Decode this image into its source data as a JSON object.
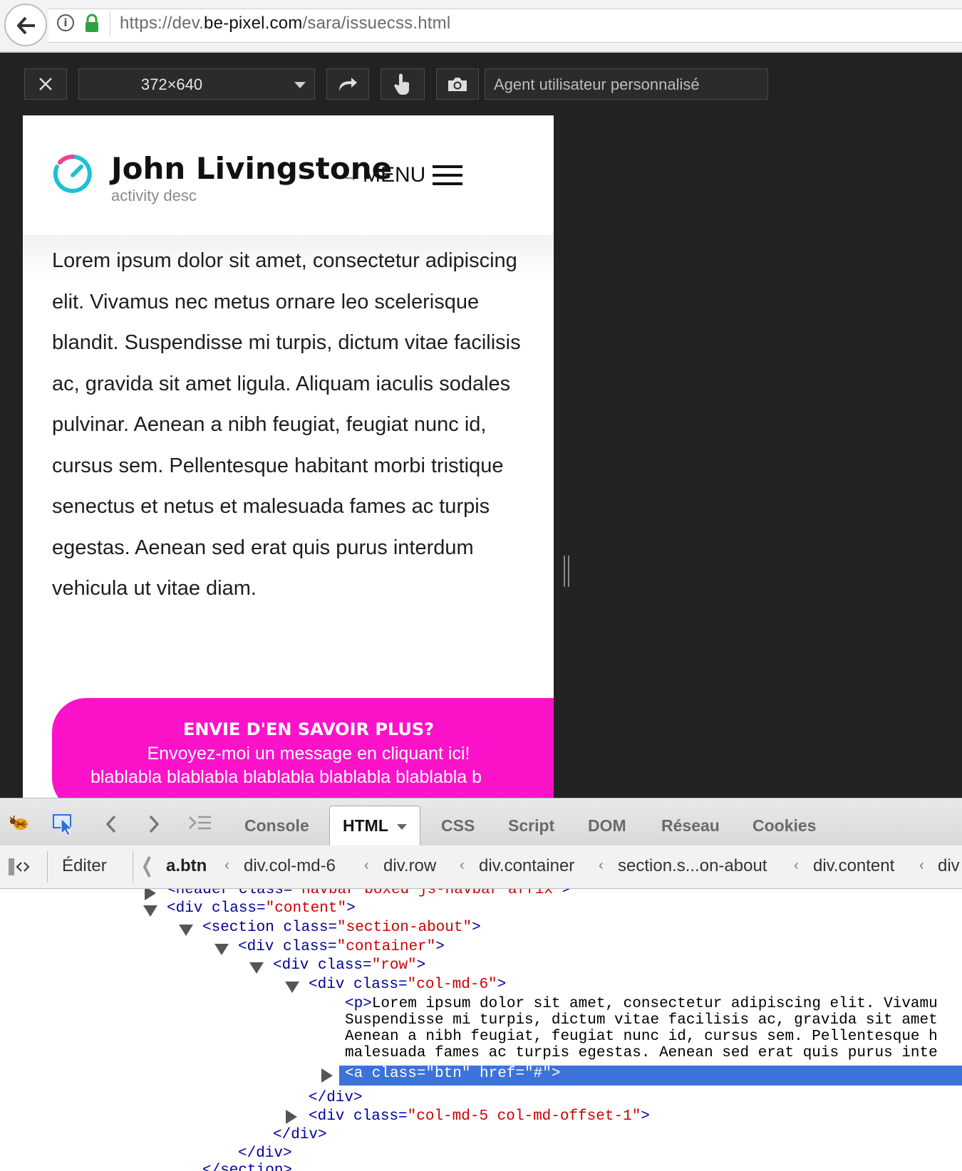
{
  "browser": {
    "url_prefix": "https://dev.",
    "url_domain": "be-pixel.com",
    "url_path": "/sara/issuecss.html"
  },
  "rdm": {
    "size": "372×640",
    "user_agent_placeholder": "Agent utilisateur personnalisé"
  },
  "site": {
    "name": "John Livingstone",
    "desc": "activity desc",
    "menu_arrow": "→",
    "menu_label": "MENU",
    "body": "Lorem ipsum dolor sit amet, consectetur adipiscing elit. Vivamus nec metus ornare leo scelerisque blandit. Suspendisse mi turpis, dictum vitae facilisis ac, gravida sit amet ligula. Aliquam iaculis sodales pulvinar. Aenean a nibh feugiat, feugiat nunc id, cursus sem. Pellentesque habitant morbi tristique senectus et netus et malesuada fames ac turpis egestas. Aenean sed erat quis purus interdum vehicula ut vitae diam.",
    "cta_title": "ENVIE D'EN SAVOIR PLUS?",
    "cta_sub": "Envoyez-moi un message en cliquant ici!",
    "cta_blah": "blablabla blablabla blablabla blablabla blablabla b"
  },
  "firebug": {
    "tabs": [
      "Console",
      "HTML",
      "CSS",
      "Script",
      "DOM",
      "Réseau",
      "Cookies"
    ],
    "edit_label": "Éditer",
    "breadcrumbs": [
      "a.btn",
      "div.col-md-6",
      "div.row",
      "div.container",
      "section.s...on-about",
      "div.content",
      "div"
    ],
    "tree": {
      "r0": {
        "tag_open": "<header",
        "attr": " class=",
        "val": "\"navbar boxed js-navbar affix\"",
        "tag_close": ">"
      },
      "r1": {
        "tag_open": "<div",
        "attr": " class=",
        "val": "\"content\"",
        "tag_close": ">"
      },
      "r2": {
        "tag_open": "<section",
        "attr": " class=",
        "val": "\"section-about\"",
        "tag_close": ">"
      },
      "r3": {
        "tag_open": "<div",
        "attr": " class=",
        "val": "\"container\"",
        "tag_close": ">"
      },
      "r4": {
        "tag_open": "<div",
        "attr": " class=",
        "val": "\"row\"",
        "tag_close": ">"
      },
      "r5": {
        "tag_open": "<div",
        "attr": " class=",
        "val": "\"col-md-6\"",
        "tag_close": ">"
      },
      "p_tag": "<p>",
      "p_lines": [
        "Lorem ipsum dolor sit amet, consectetur adipiscing elit. Vivamu",
        "Suspendisse mi turpis, dictum vitae facilisis ac, gravida sit amet",
        "Aenean a nibh feugiat, feugiat nunc id, cursus sem. Pellentesque h",
        "malesuada fames ac turpis egestas. Aenean sed erat quis purus inte"
      ],
      "selected": "<a class=\"btn\" href=\"#\">",
      "close_div1": "</div>",
      "r6": {
        "tag_open": "<div",
        "attr": " class=",
        "val": "\"col-md-5 col-md-offset-1\"",
        "tag_close": ">"
      },
      "close_div2": "</div>",
      "close_div3": "</div>",
      "close_section": "</section>"
    }
  },
  "colors": {
    "cta": "#fb12c9",
    "logo_pink": "#e84393",
    "logo_cyan": "#1fc0d4",
    "selection": "#3b73d9"
  }
}
